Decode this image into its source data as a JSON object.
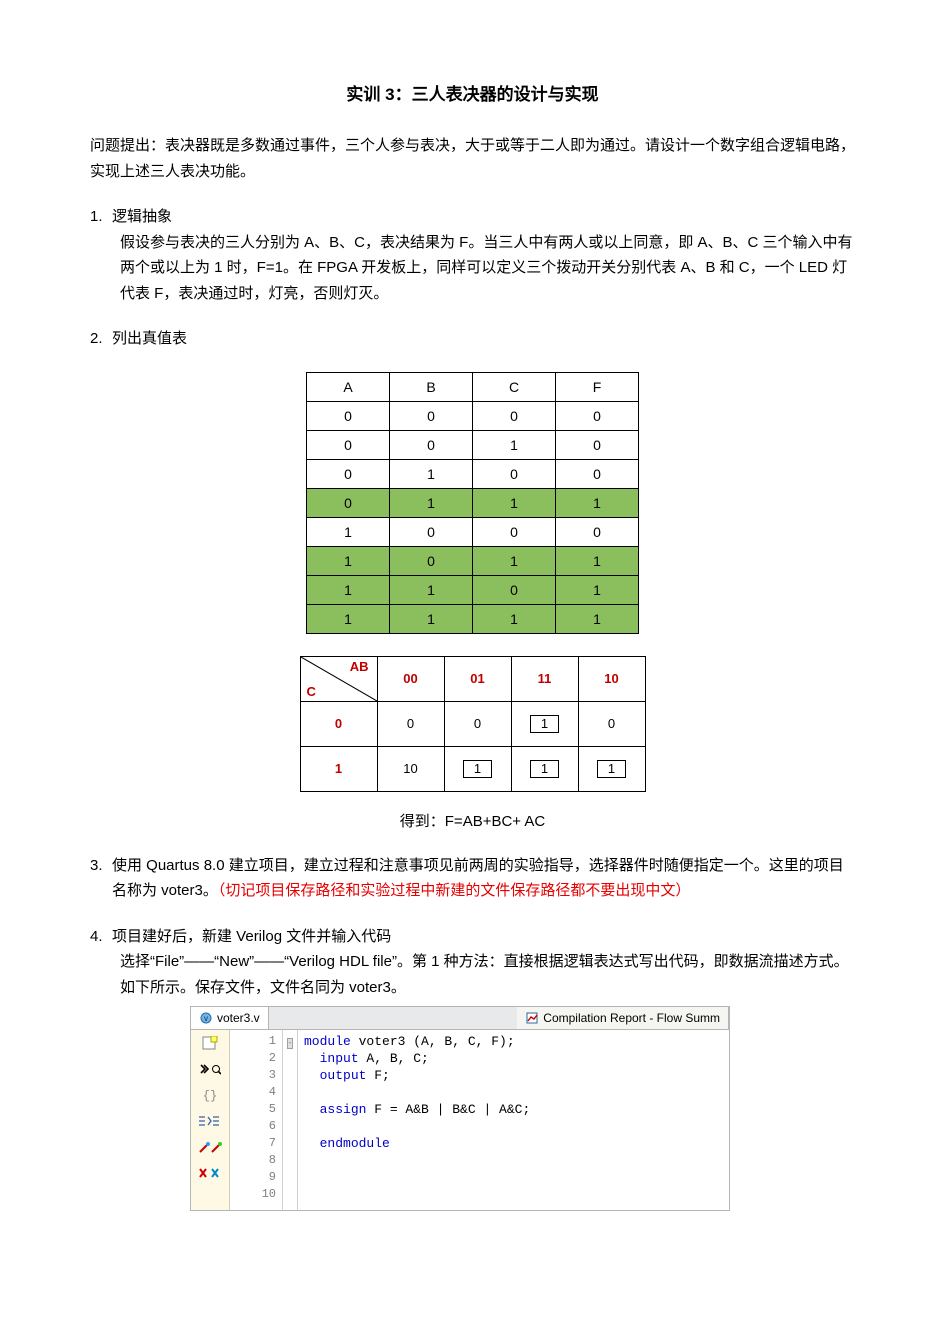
{
  "title": "实训 3：三人表决器的设计与实现",
  "intro": "问题提出：表决器既是多数通过事件，三个人参与表决，大于或等于二人即为通过。请设计一个数字组合逻辑电路，实现上述三人表决功能。",
  "s1": {
    "num": "1.",
    "head": "逻辑抽象",
    "body": "假设参与表决的三人分别为 A、B、C，表决结果为 F。当三人中有两人或以上同意，即 A、B、C 三个输入中有两个或以上为 1 时，F=1。在 FPGA 开发板上，同样可以定义三个拨动开关分别代表 A、B 和 C，一个 LED 灯代表 F，表决通过时，灯亮，否则灯灭。"
  },
  "s2": {
    "num": "2.",
    "head": "列出真值表"
  },
  "truth": {
    "head": [
      "A",
      "B",
      "C",
      "F"
    ],
    "rows": [
      {
        "v": [
          "0",
          "0",
          "0",
          "0"
        ],
        "hl": false
      },
      {
        "v": [
          "0",
          "0",
          "1",
          "0"
        ],
        "hl": false
      },
      {
        "v": [
          "0",
          "1",
          "0",
          "0"
        ],
        "hl": false
      },
      {
        "v": [
          "0",
          "1",
          "1",
          "1"
        ],
        "hl": true
      },
      {
        "v": [
          "1",
          "0",
          "0",
          "0"
        ],
        "hl": false
      },
      {
        "v": [
          "1",
          "0",
          "1",
          "1"
        ],
        "hl": true
      },
      {
        "v": [
          "1",
          "1",
          "0",
          "1"
        ],
        "hl": true
      },
      {
        "v": [
          "1",
          "1",
          "1",
          "1"
        ],
        "hl": true
      }
    ]
  },
  "kmap": {
    "ab_label": "AB",
    "c_label": "C",
    "cols": [
      "00",
      "01",
      "11",
      "10"
    ],
    "rows": [
      {
        "r": "0",
        "vals": [
          "0",
          "0",
          "1",
          "0"
        ],
        "grp": [
          false,
          false,
          true,
          false
        ]
      },
      {
        "r": "1",
        "vals": [
          "10",
          "1",
          "1",
          "1"
        ],
        "grp": [
          false,
          true,
          true,
          true
        ]
      }
    ]
  },
  "formula_label": "得到：",
  "formula": "F=AB+BC+ AC",
  "s3": {
    "num": "3.",
    "body_a": "使用 Quartus 8.0 建立项目，建立过程和注意事项见前两周的实验指导，选择器件时随便指定一个。这里的项目名称为 voter3。",
    "body_b": "（切记项目保存路径和实验过程中新建的文件保存路径都不要出现中文）"
  },
  "s4": {
    "num": "4.",
    "line1": "项目建好后，新建 Verilog 文件并输入代码",
    "line2": "选择“File”——“New”——“Verilog HDL file”。第 1 种方法：直接根据逻辑表达式写出代码，即数据流描述方式。如下所示。保存文件，文件名同为 voter3。"
  },
  "editor": {
    "tab1": "voter3.v",
    "tab2": "Compilation Report - Flow Summ",
    "lines": [
      "1",
      "2",
      "3",
      "4",
      "5",
      "6",
      "7",
      "8",
      "9",
      "10"
    ],
    "code": {
      "l1a": "module",
      "l1b": " voter3 (A, B, C, F);",
      "l2a": "input",
      "l2b": " A, B, C;",
      "l3a": "output",
      "l3b": " F;",
      "l5a": "assign",
      "l5b": " F = A&B | B&C | A&C;",
      "l7a": "endmodule"
    }
  }
}
